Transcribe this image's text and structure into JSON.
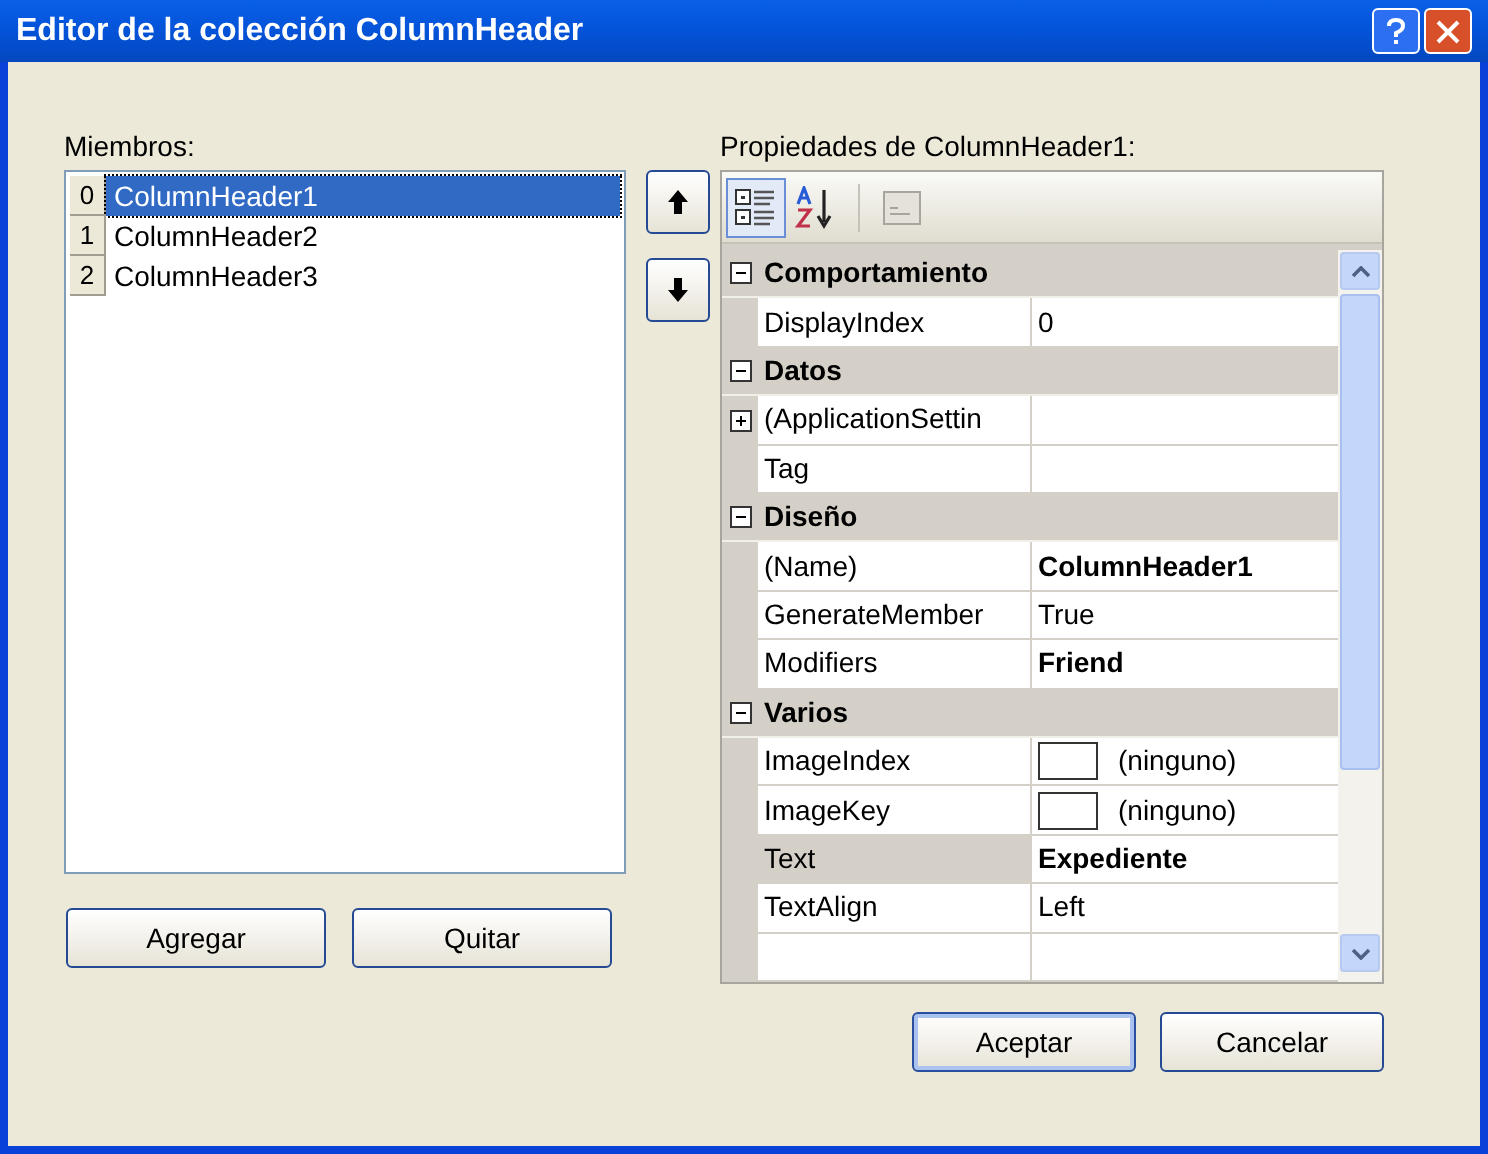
{
  "window": {
    "title": "Editor de la colección ColumnHeader"
  },
  "members": {
    "label": "Miembros:",
    "items": [
      {
        "index": "0",
        "name": "ColumnHeader1",
        "selected": true
      },
      {
        "index": "1",
        "name": "ColumnHeader2",
        "selected": false
      },
      {
        "index": "2",
        "name": "ColumnHeader3",
        "selected": false
      }
    ]
  },
  "member_buttons": [
    "Agregar",
    "Quitar"
  ],
  "properties": {
    "label": "Propiedades de ColumnHeader1:",
    "toolbar": [
      {
        "kind": "categorized",
        "selected": true
      },
      {
        "kind": "alphabetical",
        "selected": false
      },
      {
        "kind": "pages",
        "selected": false
      }
    ],
    "rows": [
      {
        "kind": "category",
        "name": "Comportamiento",
        "expanded": true
      },
      {
        "kind": "property",
        "name": "DisplayIndex",
        "value": "0",
        "selected": false
      },
      {
        "kind": "category",
        "name": "Datos",
        "expanded": true
      },
      {
        "kind": "property",
        "name": "(ApplicationSettin",
        "selected": false,
        "expandable": true
      },
      {
        "kind": "property",
        "name": "Tag",
        "selected": false
      },
      {
        "kind": "category",
        "name": "Diseño",
        "expanded": true
      },
      {
        "kind": "property",
        "name": "(Name)",
        "value": "ColumnHeader1",
        "bold": true,
        "selected": false
      },
      {
        "kind": "property",
        "name": "GenerateMember",
        "value": "True",
        "selected": false
      },
      {
        "kind": "property",
        "name": "Modifiers",
        "value": "Friend",
        "bold": true,
        "selected": false
      },
      {
        "kind": "category",
        "name": "Varios",
        "expanded": true
      },
      {
        "kind": "property",
        "name": "ImageIndex",
        "value": "(ninguno)",
        "selected": false,
        "swatch": true
      },
      {
        "kind": "property",
        "name": "ImageKey",
        "value": "(ninguno)",
        "selected": false,
        "swatch": true
      },
      {
        "kind": "property",
        "name": "Text",
        "value": "Expediente",
        "bold": true,
        "selected": true
      },
      {
        "kind": "property",
        "name": "TextAlign",
        "value": "Left",
        "selected": false
      },
      {
        "kind": "property",
        "selected": false
      }
    ]
  },
  "dialog_buttons": [
    "Aceptar",
    "Cancelar"
  ]
}
